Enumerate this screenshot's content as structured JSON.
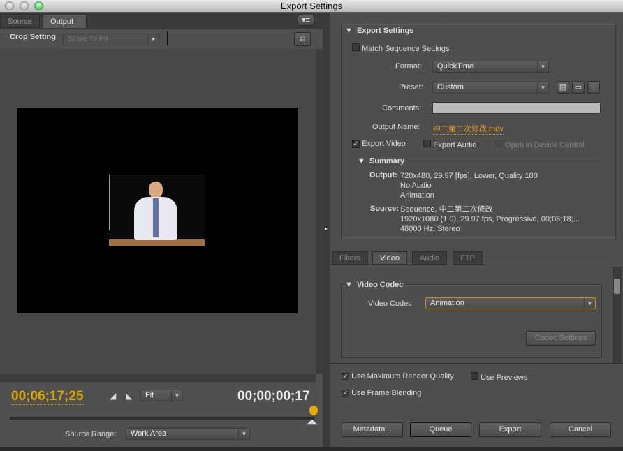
{
  "window": {
    "title": "Export Settings"
  },
  "left": {
    "tabs": [
      "Source",
      "Output"
    ],
    "active_tab": "Output",
    "crop_label": "Crop Setting",
    "crop_value": "Scale To Fit",
    "timecode_current": "00;06;17;25",
    "timecode_duration": "00;00;00;17",
    "zoom_value": "Fit",
    "source_range_label": "Source Range:",
    "source_range_value": "Work Area"
  },
  "export": {
    "section": "Export Settings",
    "match_sequence": "Match Sequence Settings",
    "match_checked": false,
    "format_label": "Format:",
    "format_value": "QuickTime",
    "preset_label": "Preset:",
    "preset_value": "Custom",
    "comments_label": "Comments:",
    "comments_value": "",
    "output_name_label": "Output Name:",
    "output_name_value": "中二第二次修改.mov",
    "export_video": "Export Video",
    "export_video_checked": true,
    "export_audio": "Export Audio",
    "export_audio_checked": false,
    "device_central": "Open in Device Central",
    "summary": {
      "title": "Summary",
      "output_label": "Output:",
      "output_lines": [
        "720x480, 29.97 [fps], Lower, Quality 100",
        "No Audio",
        "Animation"
      ],
      "source_label": "Source:",
      "source_lines": [
        "Sequence, 中二第二次修改",
        "1920x1080 (1.0), 29.97 fps, Progressive, 00;06;18;...",
        "48000 Hz, Stereo"
      ]
    }
  },
  "tabs": {
    "items": [
      "Filters",
      "Video",
      "Audio",
      "FTP"
    ],
    "active": "Video"
  },
  "video": {
    "section": "Video Codec",
    "codec_label": "Video Codec:",
    "codec_value": "Animation",
    "codec_settings": "Codec Settings"
  },
  "options": {
    "max_quality": "Use Maximum Render Quality",
    "max_quality_checked": true,
    "previews": "Use Previews",
    "previews_checked": false,
    "frame_blending": "Use Frame Blending",
    "frame_blending_checked": true
  },
  "buttons": {
    "metadata": "Metadata...",
    "queue": "Queue",
    "export": "Export",
    "cancel": "Cancel"
  },
  "colors": {
    "accent": "#e0a800",
    "link": "#e8a020"
  }
}
